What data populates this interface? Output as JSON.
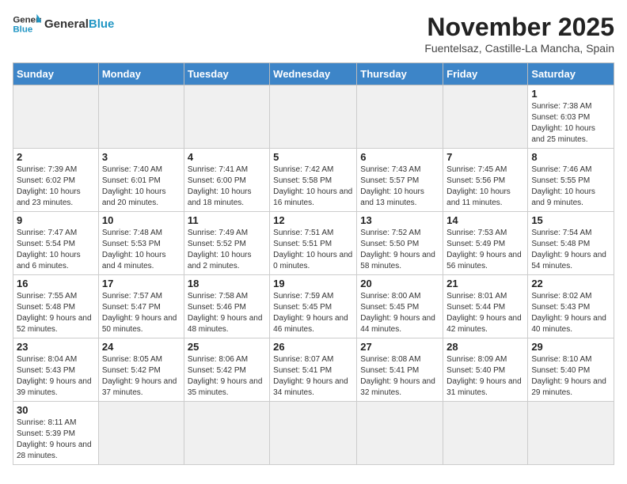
{
  "header": {
    "logo_general": "General",
    "logo_blue": "Blue",
    "month_title": "November 2025",
    "location": "Fuentelsaz, Castille-La Mancha, Spain"
  },
  "days_of_week": [
    "Sunday",
    "Monday",
    "Tuesday",
    "Wednesday",
    "Thursday",
    "Friday",
    "Saturday"
  ],
  "weeks": [
    [
      {
        "day": "",
        "info": ""
      },
      {
        "day": "",
        "info": ""
      },
      {
        "day": "",
        "info": ""
      },
      {
        "day": "",
        "info": ""
      },
      {
        "day": "",
        "info": ""
      },
      {
        "day": "",
        "info": ""
      },
      {
        "day": "1",
        "info": "Sunrise: 7:38 AM\nSunset: 6:03 PM\nDaylight: 10 hours and 25 minutes."
      }
    ],
    [
      {
        "day": "2",
        "info": "Sunrise: 7:39 AM\nSunset: 6:02 PM\nDaylight: 10 hours and 23 minutes."
      },
      {
        "day": "3",
        "info": "Sunrise: 7:40 AM\nSunset: 6:01 PM\nDaylight: 10 hours and 20 minutes."
      },
      {
        "day": "4",
        "info": "Sunrise: 7:41 AM\nSunset: 6:00 PM\nDaylight: 10 hours and 18 minutes."
      },
      {
        "day": "5",
        "info": "Sunrise: 7:42 AM\nSunset: 5:58 PM\nDaylight: 10 hours and 16 minutes."
      },
      {
        "day": "6",
        "info": "Sunrise: 7:43 AM\nSunset: 5:57 PM\nDaylight: 10 hours and 13 minutes."
      },
      {
        "day": "7",
        "info": "Sunrise: 7:45 AM\nSunset: 5:56 PM\nDaylight: 10 hours and 11 minutes."
      },
      {
        "day": "8",
        "info": "Sunrise: 7:46 AM\nSunset: 5:55 PM\nDaylight: 10 hours and 9 minutes."
      }
    ],
    [
      {
        "day": "9",
        "info": "Sunrise: 7:47 AM\nSunset: 5:54 PM\nDaylight: 10 hours and 6 minutes."
      },
      {
        "day": "10",
        "info": "Sunrise: 7:48 AM\nSunset: 5:53 PM\nDaylight: 10 hours and 4 minutes."
      },
      {
        "day": "11",
        "info": "Sunrise: 7:49 AM\nSunset: 5:52 PM\nDaylight: 10 hours and 2 minutes."
      },
      {
        "day": "12",
        "info": "Sunrise: 7:51 AM\nSunset: 5:51 PM\nDaylight: 10 hours and 0 minutes."
      },
      {
        "day": "13",
        "info": "Sunrise: 7:52 AM\nSunset: 5:50 PM\nDaylight: 9 hours and 58 minutes."
      },
      {
        "day": "14",
        "info": "Sunrise: 7:53 AM\nSunset: 5:49 PM\nDaylight: 9 hours and 56 minutes."
      },
      {
        "day": "15",
        "info": "Sunrise: 7:54 AM\nSunset: 5:48 PM\nDaylight: 9 hours and 54 minutes."
      }
    ],
    [
      {
        "day": "16",
        "info": "Sunrise: 7:55 AM\nSunset: 5:48 PM\nDaylight: 9 hours and 52 minutes."
      },
      {
        "day": "17",
        "info": "Sunrise: 7:57 AM\nSunset: 5:47 PM\nDaylight: 9 hours and 50 minutes."
      },
      {
        "day": "18",
        "info": "Sunrise: 7:58 AM\nSunset: 5:46 PM\nDaylight: 9 hours and 48 minutes."
      },
      {
        "day": "19",
        "info": "Sunrise: 7:59 AM\nSunset: 5:45 PM\nDaylight: 9 hours and 46 minutes."
      },
      {
        "day": "20",
        "info": "Sunrise: 8:00 AM\nSunset: 5:45 PM\nDaylight: 9 hours and 44 minutes."
      },
      {
        "day": "21",
        "info": "Sunrise: 8:01 AM\nSunset: 5:44 PM\nDaylight: 9 hours and 42 minutes."
      },
      {
        "day": "22",
        "info": "Sunrise: 8:02 AM\nSunset: 5:43 PM\nDaylight: 9 hours and 40 minutes."
      }
    ],
    [
      {
        "day": "23",
        "info": "Sunrise: 8:04 AM\nSunset: 5:43 PM\nDaylight: 9 hours and 39 minutes."
      },
      {
        "day": "24",
        "info": "Sunrise: 8:05 AM\nSunset: 5:42 PM\nDaylight: 9 hours and 37 minutes."
      },
      {
        "day": "25",
        "info": "Sunrise: 8:06 AM\nSunset: 5:42 PM\nDaylight: 9 hours and 35 minutes."
      },
      {
        "day": "26",
        "info": "Sunrise: 8:07 AM\nSunset: 5:41 PM\nDaylight: 9 hours and 34 minutes."
      },
      {
        "day": "27",
        "info": "Sunrise: 8:08 AM\nSunset: 5:41 PM\nDaylight: 9 hours and 32 minutes."
      },
      {
        "day": "28",
        "info": "Sunrise: 8:09 AM\nSunset: 5:40 PM\nDaylight: 9 hours and 31 minutes."
      },
      {
        "day": "29",
        "info": "Sunrise: 8:10 AM\nSunset: 5:40 PM\nDaylight: 9 hours and 29 minutes."
      }
    ],
    [
      {
        "day": "30",
        "info": "Sunrise: 8:11 AM\nSunset: 5:39 PM\nDaylight: 9 hours and 28 minutes."
      },
      {
        "day": "",
        "info": ""
      },
      {
        "day": "",
        "info": ""
      },
      {
        "day": "",
        "info": ""
      },
      {
        "day": "",
        "info": ""
      },
      {
        "day": "",
        "info": ""
      },
      {
        "day": "",
        "info": ""
      }
    ]
  ]
}
